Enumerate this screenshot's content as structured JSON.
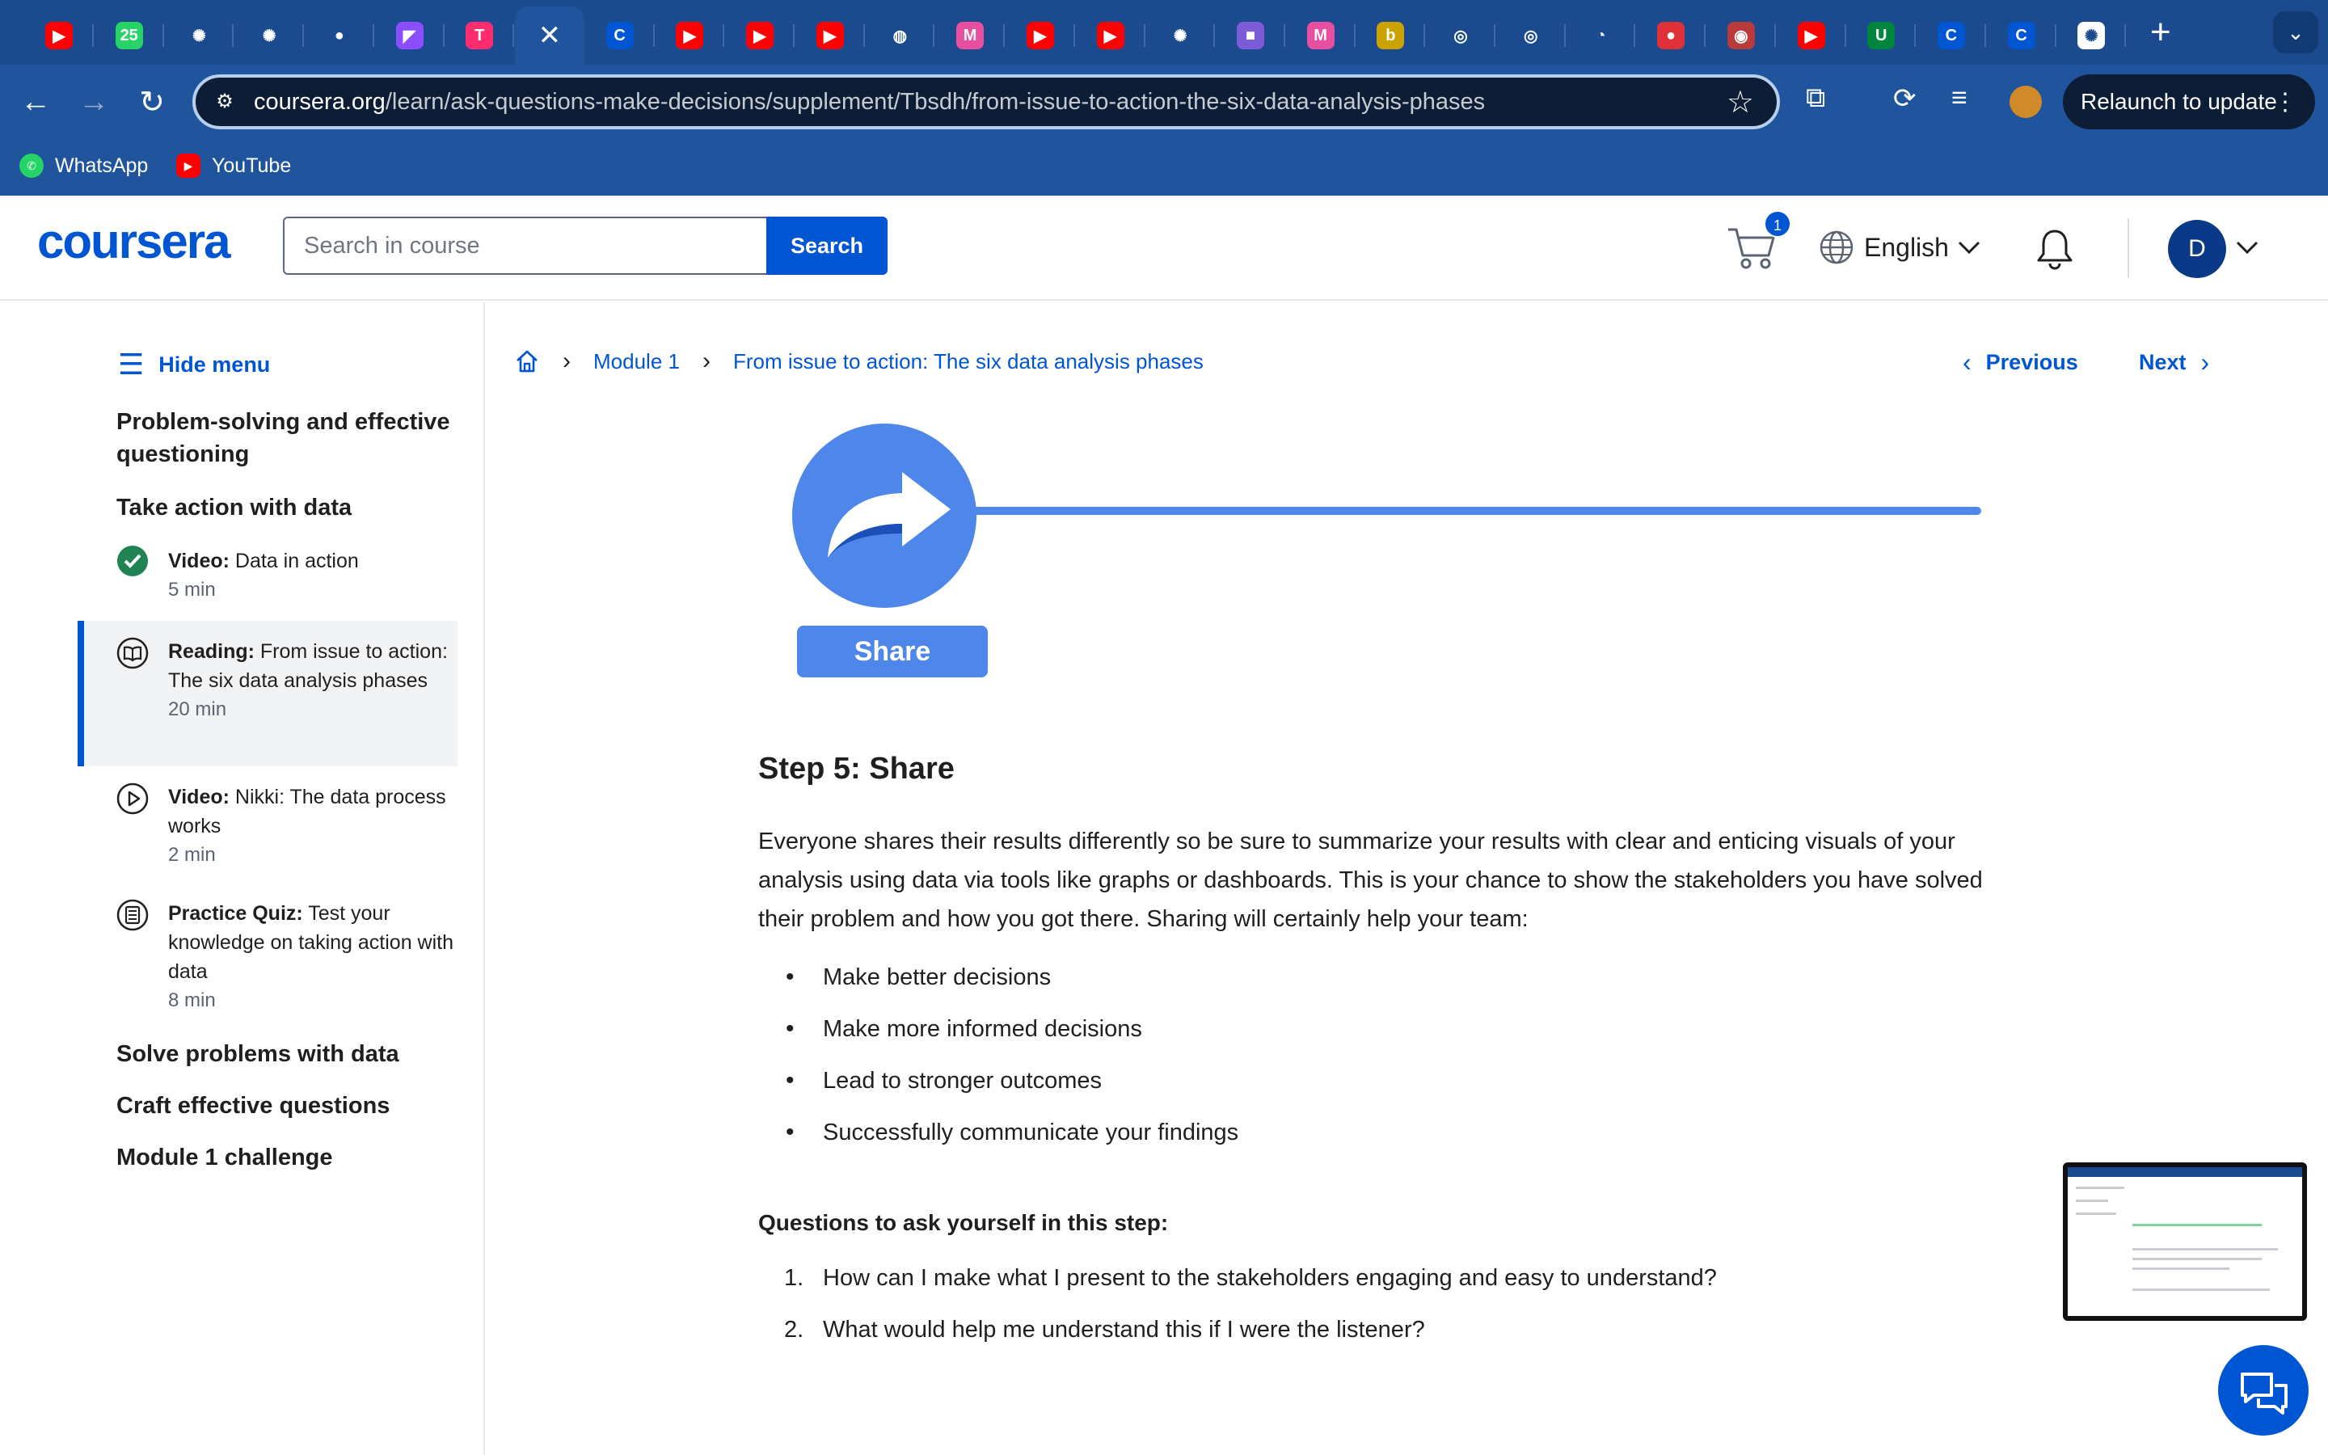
{
  "browser": {
    "tabs": [
      {
        "icon": "youtube-icon",
        "color": "#ff0000",
        "glyph": "▶"
      },
      {
        "icon": "whatsapp-icon",
        "color": "#25d366",
        "glyph": "25"
      },
      {
        "icon": "openai-icon",
        "color": "#1b4a8f",
        "glyph": "✺"
      },
      {
        "icon": "openai-icon",
        "color": "#1b4a8f",
        "glyph": "✺"
      },
      {
        "icon": "github-icon",
        "color": "#1b4a8f",
        "glyph": "●"
      },
      {
        "icon": "app-icon",
        "color": "#8a4dff",
        "glyph": "◤"
      },
      {
        "icon": "t-app-icon",
        "color": "#ff2d6f",
        "glyph": "T"
      },
      {
        "icon": "close-icon",
        "color": "#20549c",
        "glyph": "✕",
        "active": true
      },
      {
        "icon": "coursera-icon",
        "color": "#0056d2",
        "glyph": "C"
      },
      {
        "icon": "youtube-icon",
        "color": "#ff0000",
        "glyph": "▶"
      },
      {
        "icon": "youtube-icon",
        "color": "#ff0000",
        "glyph": "▶"
      },
      {
        "icon": "youtube-icon",
        "color": "#ff0000",
        "glyph": "▶"
      },
      {
        "icon": "dial-icon",
        "color": "#1b4a8f",
        "glyph": "◍"
      },
      {
        "icon": "m-icon",
        "color": "#e94fa0",
        "glyph": "M"
      },
      {
        "icon": "youtube-icon",
        "color": "#ff0000",
        "glyph": "▶"
      },
      {
        "icon": "youtube-icon",
        "color": "#ff0000",
        "glyph": "▶"
      },
      {
        "icon": "openai-icon",
        "color": "#1b4a8f",
        "glyph": "✺"
      },
      {
        "icon": "video-cam-icon",
        "color": "#7b5bd6",
        "glyph": "■"
      },
      {
        "icon": "m-icon",
        "color": "#e94fa0",
        "glyph": "M"
      },
      {
        "icon": "b-icon",
        "color": "#c9a300",
        "glyph": "b"
      },
      {
        "icon": "target-icon",
        "color": "#1b4a8f",
        "glyph": "◎"
      },
      {
        "icon": "target-icon",
        "color": "#1b4a8f",
        "glyph": "◎"
      },
      {
        "icon": "gauge-icon",
        "color": "#1b4a8f",
        "glyph": "◔"
      },
      {
        "icon": "red-ball-icon",
        "color": "#e0303a",
        "glyph": "●"
      },
      {
        "icon": "red-target-icon",
        "color": "#b93a3a",
        "glyph": "◉"
      },
      {
        "icon": "youtube-icon",
        "color": "#ff0000",
        "glyph": "▶"
      },
      {
        "icon": "my-unt-icon",
        "color": "#00853e",
        "glyph": "U"
      },
      {
        "icon": "coursera-icon",
        "color": "#0056d2",
        "glyph": "C"
      },
      {
        "icon": "coursera-icon",
        "color": "#0056d2",
        "glyph": "C"
      },
      {
        "icon": "chatgpt-icon",
        "color": "#ffffff",
        "glyph": "✺"
      }
    ],
    "new_tab": "+",
    "tab_menu": "⌄",
    "url_host": "coursera.org",
    "url_path": "/learn/ask-questions-make-decisions/supplement/Tbsdh/from-issue-to-action-the-six-data-analysis-phases",
    "relaunch_label": "Relaunch to update",
    "bookmarks": [
      {
        "label": "WhatsApp",
        "icon": "whatsapp-icon",
        "color": "#25d366"
      },
      {
        "label": "YouTube",
        "icon": "youtube-icon",
        "color": "#ff0000"
      }
    ]
  },
  "header": {
    "logo": "coursera",
    "search_placeholder": "Search in course",
    "search_button": "Search",
    "cart_count": "1",
    "language": "English",
    "user_initial": "D"
  },
  "sidebar": {
    "hide_menu": "Hide menu",
    "section_problem_solving": "Problem-solving and effective questioning",
    "section_take_action": "Take action with data",
    "items": [
      {
        "type": "Video:",
        "title": "Data in action",
        "duration": "5 min",
        "status": "completed"
      },
      {
        "type": "Reading:",
        "title": "From issue to action: The six data analysis phases",
        "duration": "20 min",
        "status": "active"
      },
      {
        "type": "Video:",
        "title": "Nikki: The data process works",
        "duration": "2 min",
        "status": "not-started"
      },
      {
        "type": "Practice Quiz:",
        "title": "Test your knowledge on taking action with data",
        "duration": "8 min",
        "status": "not-started"
      }
    ],
    "section_solve": "Solve problems with data",
    "section_craft": "Craft effective questions",
    "section_challenge": "Module 1 challenge"
  },
  "breadcrumb": {
    "module": "Module 1",
    "current": "From issue to action: The six data analysis phases"
  },
  "nav": {
    "previous": "Previous",
    "next": "Next"
  },
  "article": {
    "graphic_label": "Share",
    "heading": "Step 5: Share",
    "intro": "Everyone shares their results differently so be sure to summarize your results with clear and enticing visuals of your analysis using data via tools like graphs or dashboards. This is your chance to show the stakeholders you have solved their problem and how you got there. Sharing will certainly help your team:",
    "bullets": [
      "Make better decisions",
      "Make more informed decisions",
      "Lead to stronger outcomes",
      "Successfully communicate your findings"
    ],
    "questions_heading": "Questions to ask yourself in this step:",
    "questions": [
      {
        "num": "1.",
        "text": "How can I make what I present to the stakeholders engaging and easy to understand?"
      },
      {
        "num": "2.",
        "text": "What would help me understand this if I were the listener?"
      }
    ]
  },
  "colors": {
    "brand": "#0056d2",
    "chrome": "#20549c",
    "share_blue": "#4f86ea",
    "complete_green": "#1f8354"
  }
}
